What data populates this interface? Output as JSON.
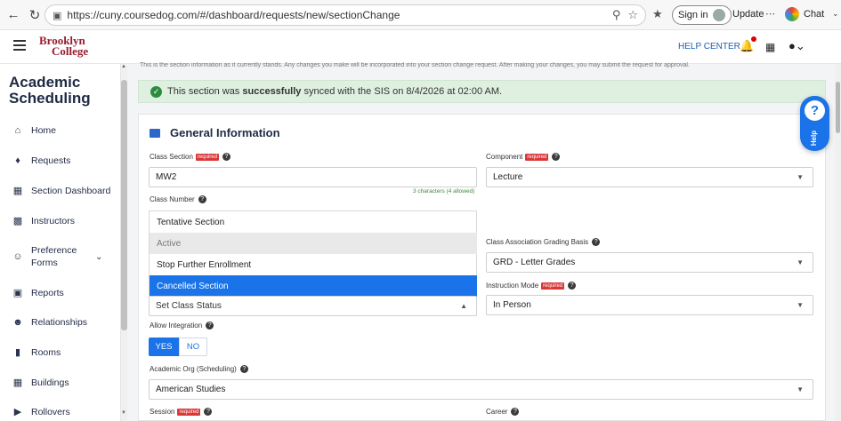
{
  "browser": {
    "url": "https://cuny.coursedog.com/#/dashboard/requests/new/sectionChange",
    "sign_in": "Sign in",
    "update": "Update",
    "chat": "Chat"
  },
  "header": {
    "brand_line1": "Brooklyn",
    "brand_line2": "College",
    "help_center": "HELP CENTER"
  },
  "sidebar": {
    "title_line1": "Academic",
    "title_line2": "Scheduling",
    "items": [
      {
        "label": "Home",
        "icon": "home-icon"
      },
      {
        "label": "Requests",
        "icon": "requests-icon"
      },
      {
        "label": "Section Dashboard",
        "icon": "clipboard-icon"
      },
      {
        "label": "Instructors",
        "icon": "person-card-icon"
      },
      {
        "label": "Preference",
        "label2": "Forms",
        "icon": "people-icon"
      },
      {
        "label": "Reports",
        "icon": "monitor-icon"
      },
      {
        "label": "Relationships",
        "icon": "group-icon"
      },
      {
        "label": "Rooms",
        "icon": "door-icon"
      },
      {
        "label": "Buildings",
        "icon": "building-icon"
      },
      {
        "label": "Rollovers",
        "icon": "rollover-icon"
      }
    ]
  },
  "banner": {
    "prefix": "This section was ",
    "bold": "successfully",
    "suffix": " synced with the SIS on 8/4/2026 at 02:00 AM."
  },
  "info_text": "This is the section information as it currently stands. Any changes you make will be incorporated into your section change request. After making your changes, you may submit the request for approval.",
  "section": {
    "title": "General Information",
    "required_badge": "required",
    "class_section": {
      "label": "Class Section",
      "value": "MW2",
      "hint": "3 characters (4 allowed)"
    },
    "component": {
      "label": "Component",
      "value": "Lecture"
    },
    "class_number": {
      "label": "Class Number"
    },
    "status_options": [
      {
        "label": "Tentative Section",
        "state": "normal"
      },
      {
        "label": "Active",
        "state": "disabled"
      },
      {
        "label": "Stop Further Enrollment",
        "state": "normal"
      },
      {
        "label": "Cancelled Section",
        "state": "selected"
      }
    ],
    "status_field": {
      "placeholder": "Set Class Status"
    },
    "grading_basis": {
      "label": "Class Association Grading Basis",
      "value": "GRD - Letter Grades"
    },
    "instruction_mode": {
      "label": "Instruction Mode",
      "value": "In Person"
    },
    "allow_integration": {
      "label": "Allow Integration",
      "yes": "YES",
      "no": "NO"
    },
    "academic_org": {
      "label": "Academic Org (Scheduling)",
      "value": "American Studies"
    },
    "session": {
      "label": "Session"
    },
    "career": {
      "label": "Career"
    }
  },
  "help_fab": {
    "symbol": "?",
    "label": "Help"
  }
}
